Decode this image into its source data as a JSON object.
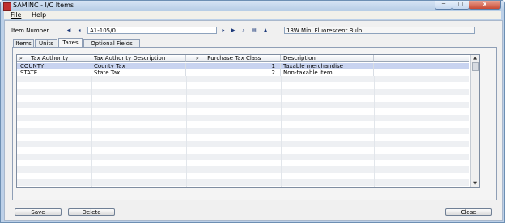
{
  "window": {
    "title": "SAMINC - I/C Items",
    "minimize_glyph": "─",
    "maximize_glyph": "□",
    "close_glyph": "x"
  },
  "menu": [
    {
      "label": "File"
    },
    {
      "label": "Help"
    }
  ],
  "item_number": {
    "label": "Item Number",
    "value": "A1-105/0",
    "description": "13W Mini Fluorescent Bulb",
    "nav_icons": [
      "first-icon",
      "previous-icon",
      "next-icon",
      "last-icon",
      "search-icon",
      "new-icon",
      "up-icon"
    ]
  },
  "tabs": [
    {
      "label": "Items"
    },
    {
      "label": "Units"
    },
    {
      "label": "Taxes",
      "active": true
    },
    {
      "label": "Optional Fields"
    }
  ],
  "grid": {
    "columns": [
      {
        "label": "Tax Authority",
        "icon": "search-icon"
      },
      {
        "label": "Tax Authority Description"
      },
      {
        "label": "Purchase Tax Class",
        "icon": "search-icon"
      },
      {
        "label": "Description"
      }
    ],
    "rows": [
      {
        "authority": "COUNTY",
        "description": "County Tax",
        "class": "1",
        "class_description": "Taxable merchandise"
      },
      {
        "authority": "STATE",
        "description": "State Tax",
        "class": "2",
        "class_description": "Non-taxable item"
      }
    ]
  },
  "buttons": {
    "save": "Save",
    "delete": "Delete",
    "close": "Close"
  }
}
